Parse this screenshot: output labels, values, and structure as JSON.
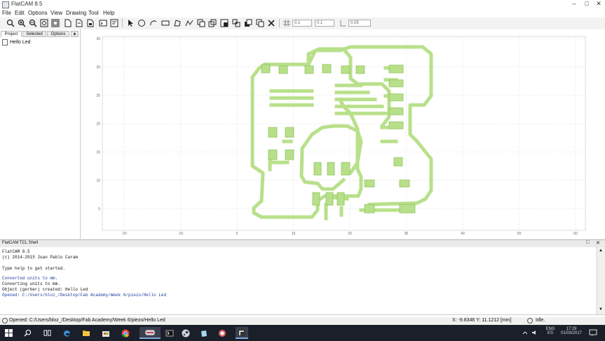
{
  "window": {
    "title": "FlatCAM 8.5",
    "minimize": "–",
    "maximize": "□",
    "close": "✕"
  },
  "menu": [
    "File",
    "Edit",
    "Options",
    "View",
    "Drawing",
    "Tool",
    "Help"
  ],
  "toolbar": {
    "icons": [
      "zoom-fit-icon",
      "zoom-in-icon",
      "zoom-out-icon",
      "replot-icon",
      "clear-plot-icon",
      "new-geometry-icon",
      "new-file-icon",
      "delete-icon",
      "shell-icon",
      "select-icon",
      "circle-icon",
      "arc-icon",
      "rectangle-icon",
      "polygon-icon",
      "path-icon",
      "move-icon",
      "copy-icon",
      "union-icon",
      "intersection-icon",
      "subtract-icon",
      "cut-icon",
      "delete-shape-icon",
      "grid-snap-icon",
      "corner-snap-icon"
    ],
    "grid_x": "0.1",
    "grid_y": "0.1",
    "snap_max": "0.05"
  },
  "left_panel": {
    "tabs": [
      "Project",
      "Selected",
      "Options"
    ],
    "active_tab": "Project",
    "tree_item": "Hello Led"
  },
  "plot": {
    "trace_color": "#b8e08a",
    "trace_edge": "#92c45c",
    "x_ticks": [
      "-20",
      "-10",
      "0",
      "10",
      "20",
      "30",
      "40",
      "50",
      "60"
    ],
    "y_ticks": [
      "35",
      "30",
      "25",
      "20",
      "15",
      "10",
      "5"
    ]
  },
  "shell": {
    "title": "FlatCAM TCL Shell",
    "lines": [
      {
        "text": "FlatCAM 8.5",
        "blue": false
      },
      {
        "text": "(c) 2014-2015 Juan Pablo Caram",
        "blue": false
      },
      {
        "text": "",
        "blue": false
      },
      {
        "text": "Type help to get started.",
        "blue": false
      },
      {
        "text": "",
        "blue": false
      },
      {
        "text": "Converted units to mm.",
        "blue": true
      },
      {
        "text": "Converting units to mm.",
        "blue": false
      },
      {
        "text": "Object (gerber) created: Hello Led",
        "blue": false
      },
      {
        "text": "Opened: C:/Users/bloz_/Desktop/Fab Academy/Week 6/piezo/Hello Led",
        "blue": true
      }
    ]
  },
  "status": {
    "message": "Opened: C:/Users/bloz_/Desktop/Fab Academy/Week 6/piezo/Hello Led",
    "coords": "X: -9.8346  Y: 11.1212 [mm]",
    "state": "Idle."
  },
  "taskbar": {
    "search_label": "Search",
    "apps": [
      "task-view-icon",
      "edge-icon",
      "file-explorer-icon",
      "store-icon",
      "chrome-icon",
      "media-icon",
      "terminal-icon",
      "steam-icon",
      "notes-icon",
      "game-icon",
      "flatcam-icon"
    ],
    "language": "ENG",
    "region": "ES",
    "time": "17:29",
    "date": "01/03/2017"
  }
}
